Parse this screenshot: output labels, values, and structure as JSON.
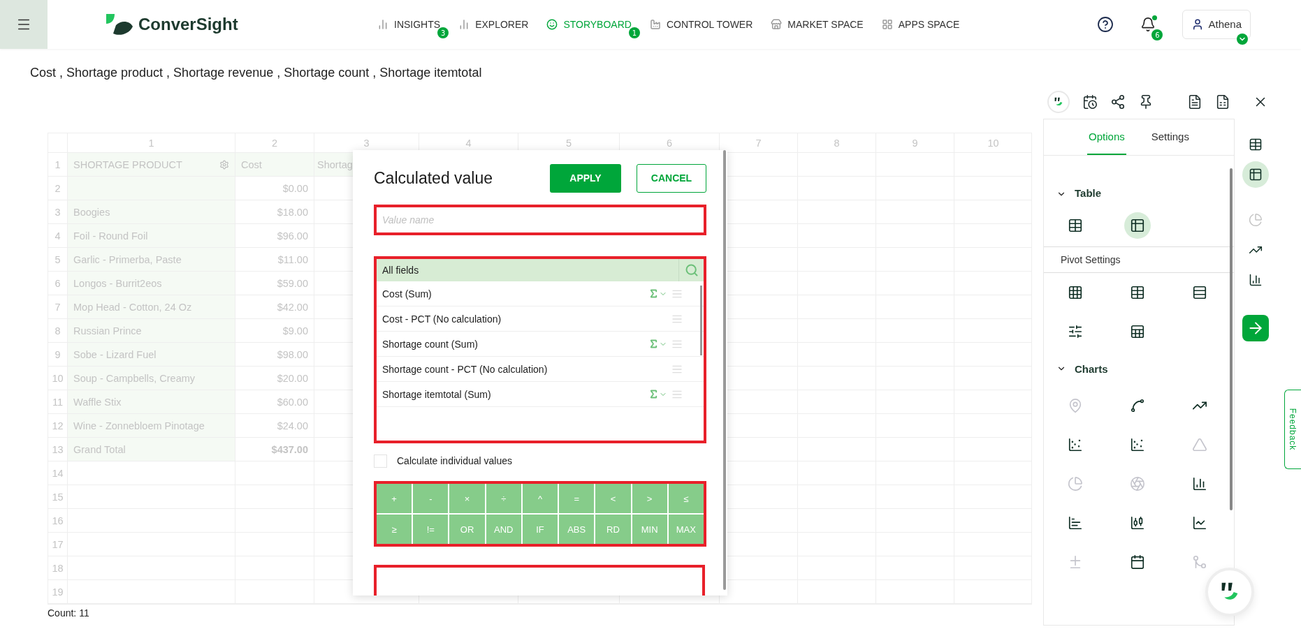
{
  "header": {
    "logo": "ConverSight",
    "nav": [
      {
        "label": "INSIGHTS",
        "kind": "bars",
        "badge": "3",
        "selected": false
      },
      {
        "label": "EXPLORER",
        "kind": "bars",
        "selected": false
      },
      {
        "label": "STORYBOARD",
        "kind": "story",
        "badge": "1",
        "selected": true
      },
      {
        "label": "CONTROL TOWER",
        "kind": "tower",
        "selected": false
      },
      {
        "label": "MARKET SPACE",
        "kind": "market",
        "selected": false
      },
      {
        "label": "APPS SPACE",
        "kind": "apps",
        "selected": false
      }
    ],
    "notifications_badge": "6",
    "user": "Athena"
  },
  "subtitle": "Cost , Shortage product , Shortage revenue , Shortage count , Shortage itemtotal",
  "grid": {
    "column_numbers": [
      "1",
      "2",
      "3",
      "4",
      "5",
      "6",
      "7",
      "8",
      "9",
      "10"
    ],
    "header": [
      "SHORTAGE PRODUCT",
      "Cost",
      "Shortag"
    ],
    "rows": [
      [
        "",
        "$0.00"
      ],
      [
        "Boogies",
        "$18.00"
      ],
      [
        "Foil - Round Foil",
        "$96.00"
      ],
      [
        "Garlic - Primerba, Paste",
        "$11.00"
      ],
      [
        "Longos - Burrit2eos",
        "$59.00"
      ],
      [
        "Mop Head - Cotton, 24 Oz",
        "$42.00"
      ],
      [
        "Russian Prince",
        "$9.00"
      ],
      [
        "Sobe - Lizard Fuel",
        "$98.00"
      ],
      [
        "Soup - Campbells, Creamy",
        "$20.00"
      ],
      [
        "Waffle Stix",
        "$60.00"
      ],
      [
        "Wine - Zonnebloem Pinotage",
        "$24.00"
      ],
      [
        "Grand Total",
        "$437.00"
      ]
    ],
    "row_numbers": [
      "1",
      "2",
      "3",
      "4",
      "5",
      "6",
      "7",
      "8",
      "9",
      "10",
      "11",
      "12",
      "13",
      "14",
      "15",
      "16",
      "17",
      "18",
      "19"
    ],
    "count": "Count: 11"
  },
  "dialog": {
    "title": "Calculated value",
    "apply": "APPLY",
    "cancel": "CANCEL",
    "value_field": {
      "placeholder": "Value name",
      "highlighted": true
    },
    "fields": {
      "header": "All fields",
      "highlighted": true,
      "items": [
        {
          "label": "Cost (Sum)",
          "aggregated": true
        },
        {
          "label": "Cost - PCT (No calculation)",
          "aggregated": false
        },
        {
          "label": "Shortage count (Sum)",
          "aggregated": true
        },
        {
          "label": "Shortage count - PCT (No calculation)",
          "aggregated": false
        },
        {
          "label": "Shortage itemtotal (Sum)",
          "aggregated": true
        }
      ]
    },
    "individual": {
      "label": "Calculate individual values",
      "checked": false
    },
    "operators": {
      "highlighted": true,
      "items": [
        "+",
        "-",
        "×",
        "÷",
        "^",
        "=",
        "<",
        ">",
        "≤",
        "≥",
        "!=",
        "OR",
        "AND",
        "IF",
        "ABS",
        "RD",
        "MIN",
        "MAX"
      ]
    },
    "formula_field": {
      "highlighted": true
    }
  },
  "panel": {
    "toolbar": [
      {
        "kind": "bot"
      },
      {
        "kind": "report"
      },
      {
        "kind": "share"
      },
      {
        "kind": "pin"
      },
      {
        "kind": "pdf"
      },
      {
        "kind": "xlsx"
      },
      {
        "kind": "close"
      }
    ],
    "tabs": [
      {
        "label": "Options",
        "selected": true
      },
      {
        "label": "Settings",
        "selected": false
      }
    ],
    "table_heading": "Table",
    "table_items": [
      {
        "kind": "table",
        "selected": false
      },
      {
        "kind": "pivot",
        "selected": true
      }
    ],
    "pivot_heading": "Pivot Settings",
    "pivot_items": [
      {
        "kind": "grid"
      },
      {
        "kind": "table"
      },
      {
        "kind": "rows"
      },
      {
        "kind": "sliders"
      },
      {
        "kind": "sheet"
      }
    ],
    "charts_heading": "Charts",
    "chart_items": [
      {
        "kind": "map",
        "disabled": true
      },
      {
        "kind": "spline",
        "disabled": false
      },
      {
        "kind": "trend",
        "disabled": false
      },
      {
        "kind": "scatter",
        "disabled": false
      },
      {
        "kind": "bubble",
        "disabled": false
      },
      {
        "kind": "funnel",
        "disabled": true
      },
      {
        "kind": "pie",
        "disabled": true
      },
      {
        "kind": "donut",
        "disabled": true
      },
      {
        "kind": "column",
        "disabled": false
      },
      {
        "kind": "hbar",
        "disabled": false
      },
      {
        "kind": "waterfall",
        "disabled": false
      },
      {
        "kind": "combo",
        "disabled": false
      },
      {
        "kind": "diff",
        "disabled": true
      },
      {
        "kind": "calendar",
        "disabled": false
      },
      {
        "kind": "sankey",
        "disabled": true
      }
    ],
    "rail": [
      {
        "kind": "table",
        "selected": false,
        "disabled": false
      },
      {
        "kind": "pivot",
        "selected": true,
        "disabled": false
      },
      {
        "kind": "pie",
        "selected": false,
        "disabled": true
      },
      {
        "kind": "trend",
        "selected": false,
        "disabled": false
      },
      {
        "kind": "column",
        "selected": false,
        "disabled": false
      },
      {
        "kind": "arrow",
        "selected": false,
        "disabled": false
      }
    ],
    "feedback": "Feedback"
  }
}
